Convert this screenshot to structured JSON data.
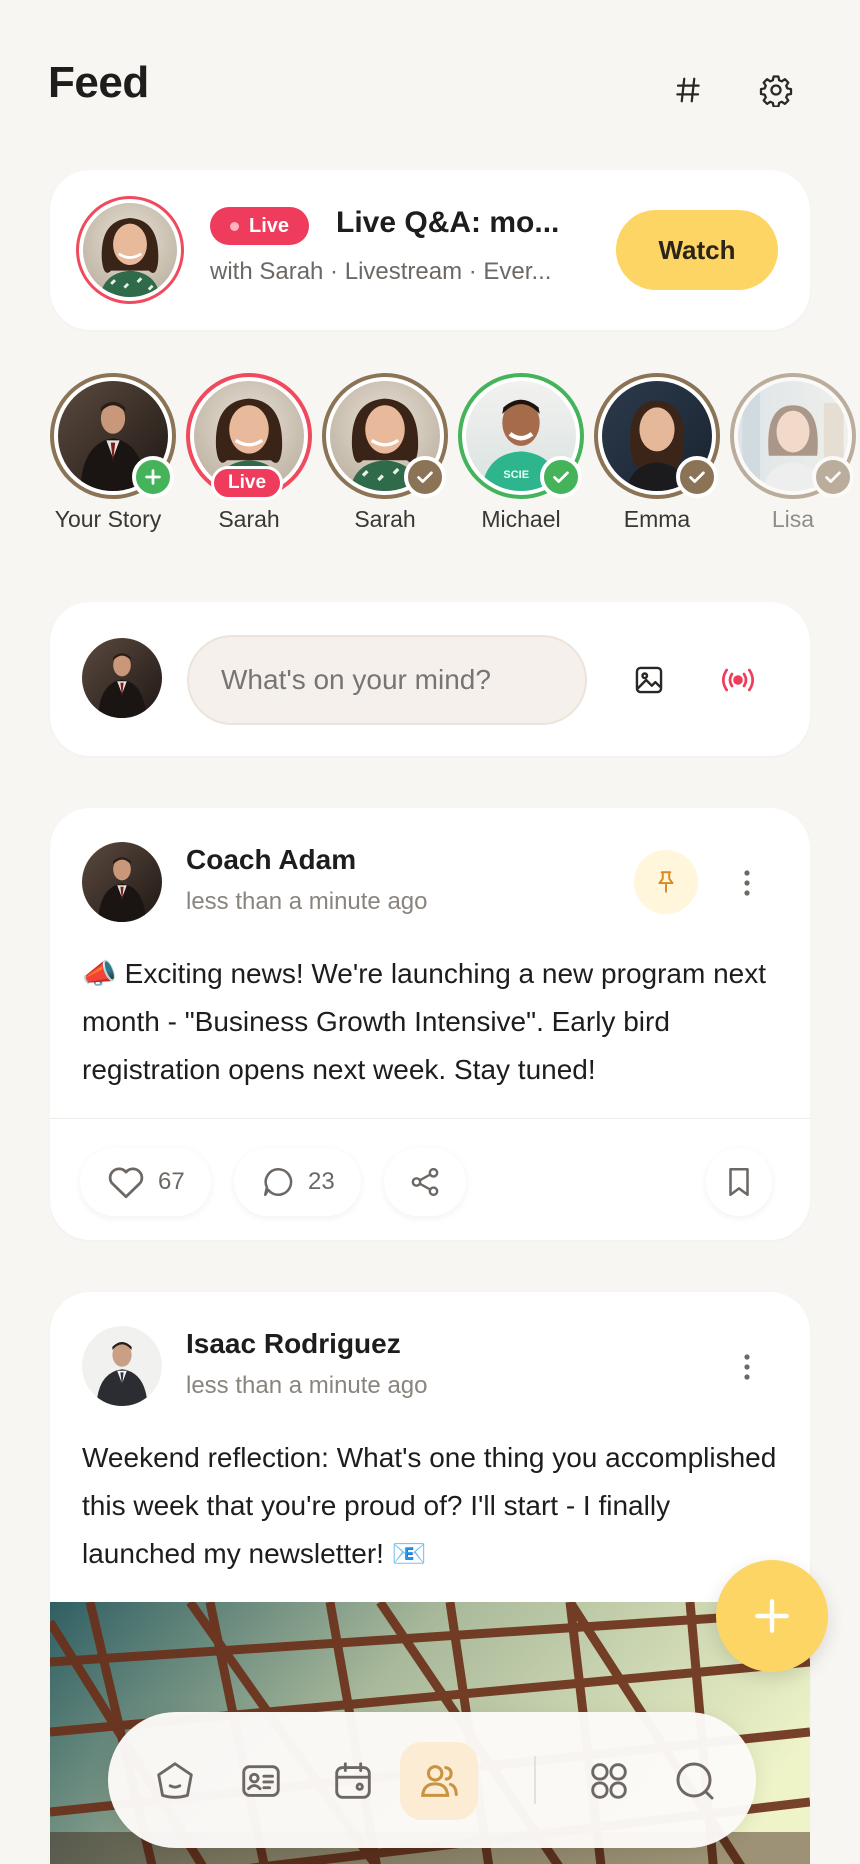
{
  "header": {
    "title": "Feed",
    "hashtag_icon": "hashtag-icon",
    "settings_icon": "gear-icon"
  },
  "live_banner": {
    "badge": "Live",
    "title": "Live Q&A: mo...",
    "subtitle": "with Sarah · Livestream · Ever...",
    "watch_label": "Watch"
  },
  "stories": [
    {
      "name": "Your Story",
      "badge": "add"
    },
    {
      "name": "Sarah",
      "badge": "live",
      "live_label": "Live"
    },
    {
      "name": "Sarah",
      "badge": "check"
    },
    {
      "name": "Michael",
      "badge": "check-green"
    },
    {
      "name": "Emma",
      "badge": "check"
    },
    {
      "name": "Lisa",
      "badge": "check"
    }
  ],
  "composer": {
    "placeholder": "What's on your mind?",
    "image_icon": "image-icon",
    "live_icon": "broadcast-icon"
  },
  "posts": [
    {
      "author": "Coach Adam",
      "time": "less than a minute ago",
      "pinned": true,
      "text": "📣 Exciting news! We're launching a new program next month - \"Business Growth Intensive\". Early bird registration opens next week. Stay tuned!",
      "likes": "67",
      "comments": "23"
    },
    {
      "author": "Isaac Rodriguez",
      "time": "less than a minute ago",
      "pinned": false,
      "text": "Weekend reflection: What's one thing you accomplished this week that you're proud of? I'll start - I finally launched my newsletter! 📧"
    }
  ],
  "nav": {
    "items": [
      "home-icon",
      "contact-card-icon",
      "calendar-icon",
      "community-icon",
      "apps-icon",
      "search-icon"
    ],
    "active": "community-icon"
  },
  "colors": {
    "accent_yellow": "#fcd565",
    "live_red": "#ef3b5c",
    "story_ring": "#8b7355",
    "online_green": "#45b35a",
    "background": "#f8f6f3"
  }
}
